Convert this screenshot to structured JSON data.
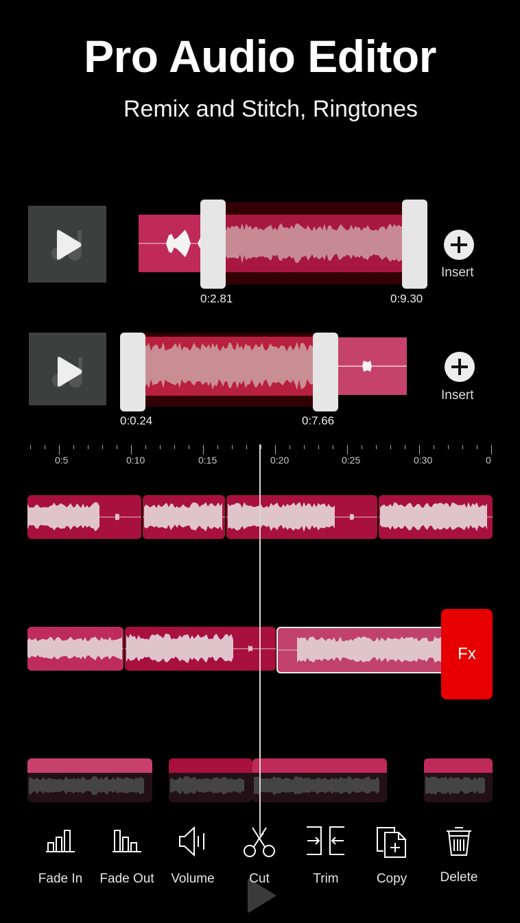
{
  "header": {
    "title": "Pro Audio Editor",
    "subtitle": "Remix and Stitch, Ringtones"
  },
  "editors": [
    {
      "thumbnail_icon": "play-music-icon",
      "start_time": "0:2.81",
      "end_time": "0:9.30",
      "insert_label": "Insert"
    },
    {
      "thumbnail_icon": "play-music-icon",
      "start_time": "0:0.24",
      "end_time": "0:7.66",
      "insert_label": "Insert"
    }
  ],
  "timeline": {
    "ruler_labels": [
      "0:5",
      "0:10",
      "0:15",
      "0:20",
      "0:25",
      "0:30",
      "0"
    ],
    "fx_label": "Fx"
  },
  "toolbar": {
    "items": [
      {
        "label": "Fade In",
        "icon": "fade-in-icon"
      },
      {
        "label": "Fade Out",
        "icon": "fade-out-icon"
      },
      {
        "label": "Volume",
        "icon": "volume-icon"
      },
      {
        "label": "Cut",
        "icon": "scissors-icon"
      },
      {
        "label": "Trim",
        "icon": "trim-icon"
      },
      {
        "label": "Copy",
        "icon": "copy-icon"
      },
      {
        "label": "Delete",
        "icon": "trash-icon"
      }
    ]
  },
  "colors": {
    "clip_pink": "#bf2a5a",
    "clip_crimson": "#a8103e",
    "selection_dark": "#320004",
    "fx_red": "#e60000",
    "handle": "#e6e6e6"
  }
}
